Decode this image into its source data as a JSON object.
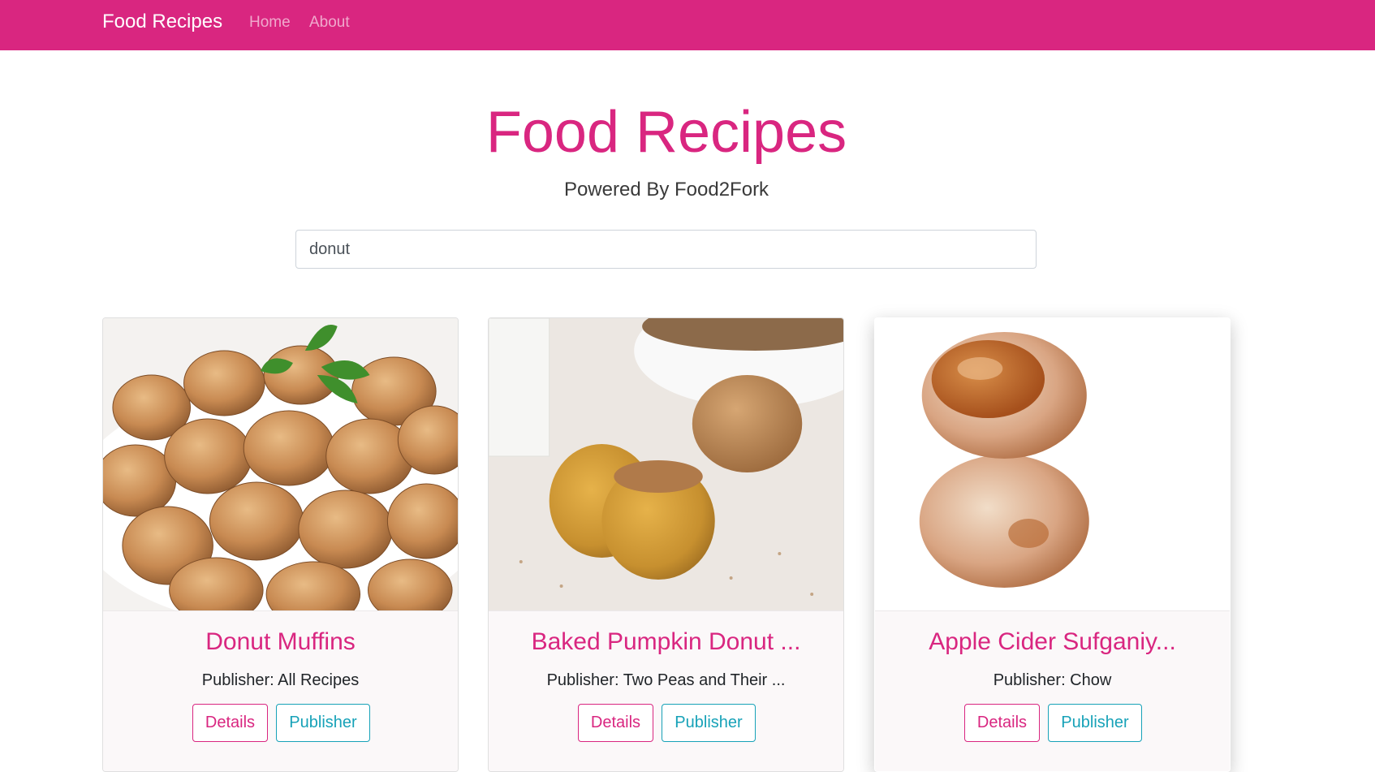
{
  "navbar": {
    "brand": "Food Recipes",
    "links": [
      "Home",
      "About"
    ]
  },
  "hero": {
    "title": "Food Recipes",
    "subtitle": "Powered By Food2Fork"
  },
  "search": {
    "value": "donut"
  },
  "colors": {
    "brand": "#d92680",
    "details_button": "#d92680",
    "publisher_button": "#17a2b8"
  },
  "recipes": [
    {
      "title": "Donut Muffins",
      "publisher": "Publisher: All Recipes",
      "image_icon": "donut-muffins-photo",
      "details_label": "Details",
      "publisher_label": "Publisher"
    },
    {
      "title": "Baked Pumpkin Donut ...",
      "publisher": "Publisher: Two Peas and Their ...",
      "image_icon": "pumpkin-donut-photo",
      "details_label": "Details",
      "publisher_label": "Publisher"
    },
    {
      "title": "Apple Cider Sufganiy...",
      "publisher": "Publisher: Chow",
      "image_icon": "sufganiyot-photo",
      "details_label": "Details",
      "publisher_label": "Publisher"
    }
  ]
}
